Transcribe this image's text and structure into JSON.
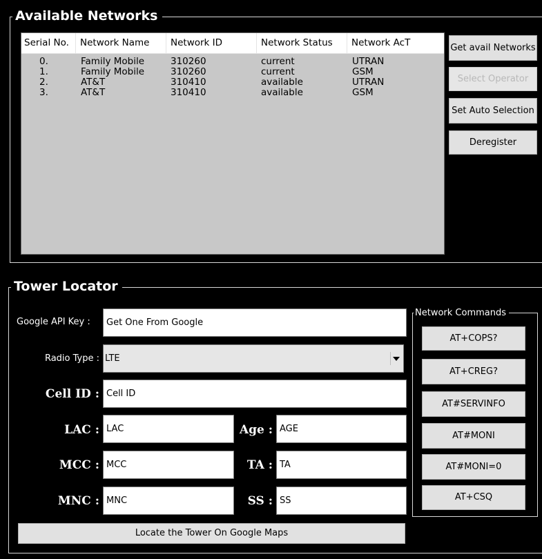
{
  "networks": {
    "title": "Available Networks",
    "columns": [
      "Serial No.",
      "Network Name",
      "Network ID",
      "Network Status",
      "Network AcT"
    ],
    "rows": [
      {
        "serial": "0.",
        "name": "Family Mobile",
        "id": "310260",
        "status": "current",
        "act": "UTRAN"
      },
      {
        "serial": "1.",
        "name": "Family Mobile",
        "id": "310260",
        "status": "current",
        "act": "GSM"
      },
      {
        "serial": "2.",
        "name": "AT&T",
        "id": "310410",
        "status": "available",
        "act": "UTRAN"
      },
      {
        "serial": "3.",
        "name": "AT&T",
        "id": "310410",
        "status": "available",
        "act": "GSM"
      }
    ],
    "buttons": {
      "get_avail": "Get avail Networks",
      "select_operator": "Select Operator",
      "set_auto": "Set Auto Selection",
      "deregister": "Deregister"
    }
  },
  "tower": {
    "title": "Tower Locator",
    "api_key_label": "Google API Key :",
    "api_key_value": "Get One From Google",
    "radio_type_label": "Radio Type :",
    "radio_type_value": "LTE",
    "cell_id_label": "Cell ID :",
    "cell_id_value": "Cell ID",
    "lac_label": "LAC :",
    "lac_value": "LAC",
    "age_label": "Age :",
    "age_value": "AGE",
    "mcc_label": "MCC :",
    "mcc_value": "MCC",
    "ta_label": "TA :",
    "ta_value": "TA",
    "mnc_label": "MNC :",
    "mnc_value": "MNC",
    "ss_label": "SS :",
    "ss_value": "SS",
    "locate_button": "Locate the Tower On Google Maps"
  },
  "commands": {
    "title": "Network Commands",
    "buttons": [
      "AT+COPS?",
      "AT+CREG?",
      "AT#SERVINFO",
      "AT#MONI",
      "AT#MONI=0",
      "AT+CSQ"
    ]
  },
  "icons": {
    "combo_arrow": "chevron-down-icon"
  }
}
